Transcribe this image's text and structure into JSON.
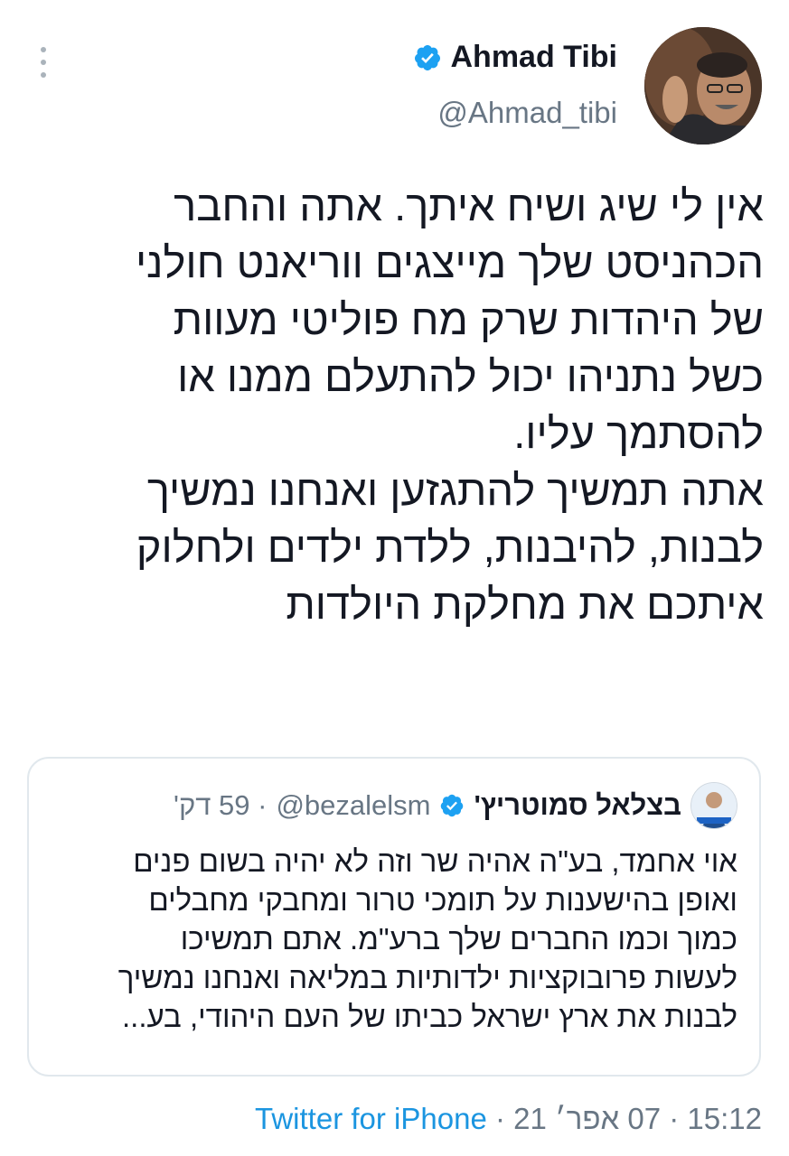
{
  "author": {
    "name": "Ahmad Tibi",
    "handle": "@Ahmad_tibi"
  },
  "tweet": {
    "text": "אין לי שיג ושיח איתך. אתה והחבר\nהכהניסט שלך מייצגים ווריאנט חולני\nשל היהדות שרק מח פוליטי מעוות\nכשל נתניהו יכול להתעלם ממנו או\nלהסתמך עליו.\nאתה תמשיך להתגזען ואנחנו נמשיך\nלבנות, להיבנות, ללדת ילדים ולחלוק\nאיתכם את מחלקת היולדות"
  },
  "quoted_tweet": {
    "name": "בצלאל סמוטריץ'",
    "handle": "@bezalelsm",
    "time": "· 59 דק'",
    "text": "אוי אחמד, בע\"ה אהיה שר וזה לא יהיה בשום פנים\nואופן בהישענות על תומכי טרור ומחבקי מחבלים\nכמוך וכמו החברים שלך ברע\"מ. אתם תמשיכו\nלעשות פרובוקציות ילדותיות במליאה ואנחנו נמשיך\nלבנות את ארץ ישראל כביתו של העם היהודי, בע..."
  },
  "footer": {
    "time": "15:12",
    "date": "07 אפר׳ 21",
    "separator": " · ",
    "source": "Twitter for iPhone"
  },
  "colors": {
    "verified": "#1da1f2",
    "link": "#1b95e0",
    "secondary_text": "#687684",
    "border": "#e1e8ed"
  },
  "icons": {
    "more": "vertical-ellipsis",
    "verified": "verified-badge"
  }
}
